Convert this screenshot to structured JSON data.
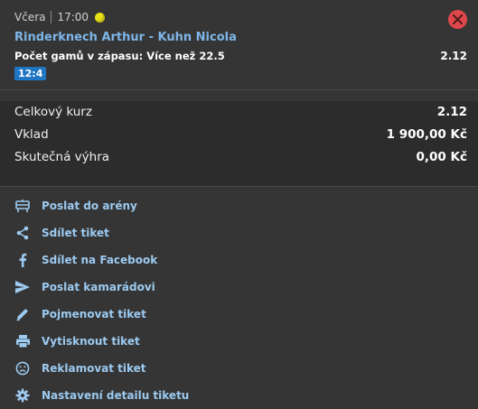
{
  "bet": {
    "day": "Včera",
    "time": "17:00",
    "match": "Rinderknech Arthur - Kuhn Nicola",
    "market": "Počet gamů v zápasu: Více než 22.5",
    "odd": "2.12",
    "score": "12:4",
    "sport_icon": "tennis-ball-icon",
    "close_icon": "close-icon"
  },
  "summary": {
    "total_odds_label": "Celkový kurz",
    "total_odds_value": "2.12",
    "stake_label": "Vklad",
    "stake_value": "1 900,00 Kč",
    "win_label": "Skutečná výhra",
    "win_value": "0,00 Kč"
  },
  "actions": [
    {
      "label": "Poslat do arény",
      "icon": "arena-icon"
    },
    {
      "label": "Sdílet tiket",
      "icon": "share-icon"
    },
    {
      "label": "Sdílet na Facebook",
      "icon": "facebook-icon"
    },
    {
      "label": "Poslat kamarádovi",
      "icon": "send-icon"
    },
    {
      "label": "Pojmenovat tiket",
      "icon": "pencil-icon"
    },
    {
      "label": "Vytisknout tiket",
      "icon": "printer-icon"
    },
    {
      "label": "Reklamovat tiket",
      "icon": "sad-face-icon"
    },
    {
      "label": "Nastavení detailu tiketu",
      "icon": "gear-icon"
    }
  ],
  "colors": {
    "accent": "#1f77c4",
    "link": "#9ccaf0",
    "close": "#e0474c"
  }
}
